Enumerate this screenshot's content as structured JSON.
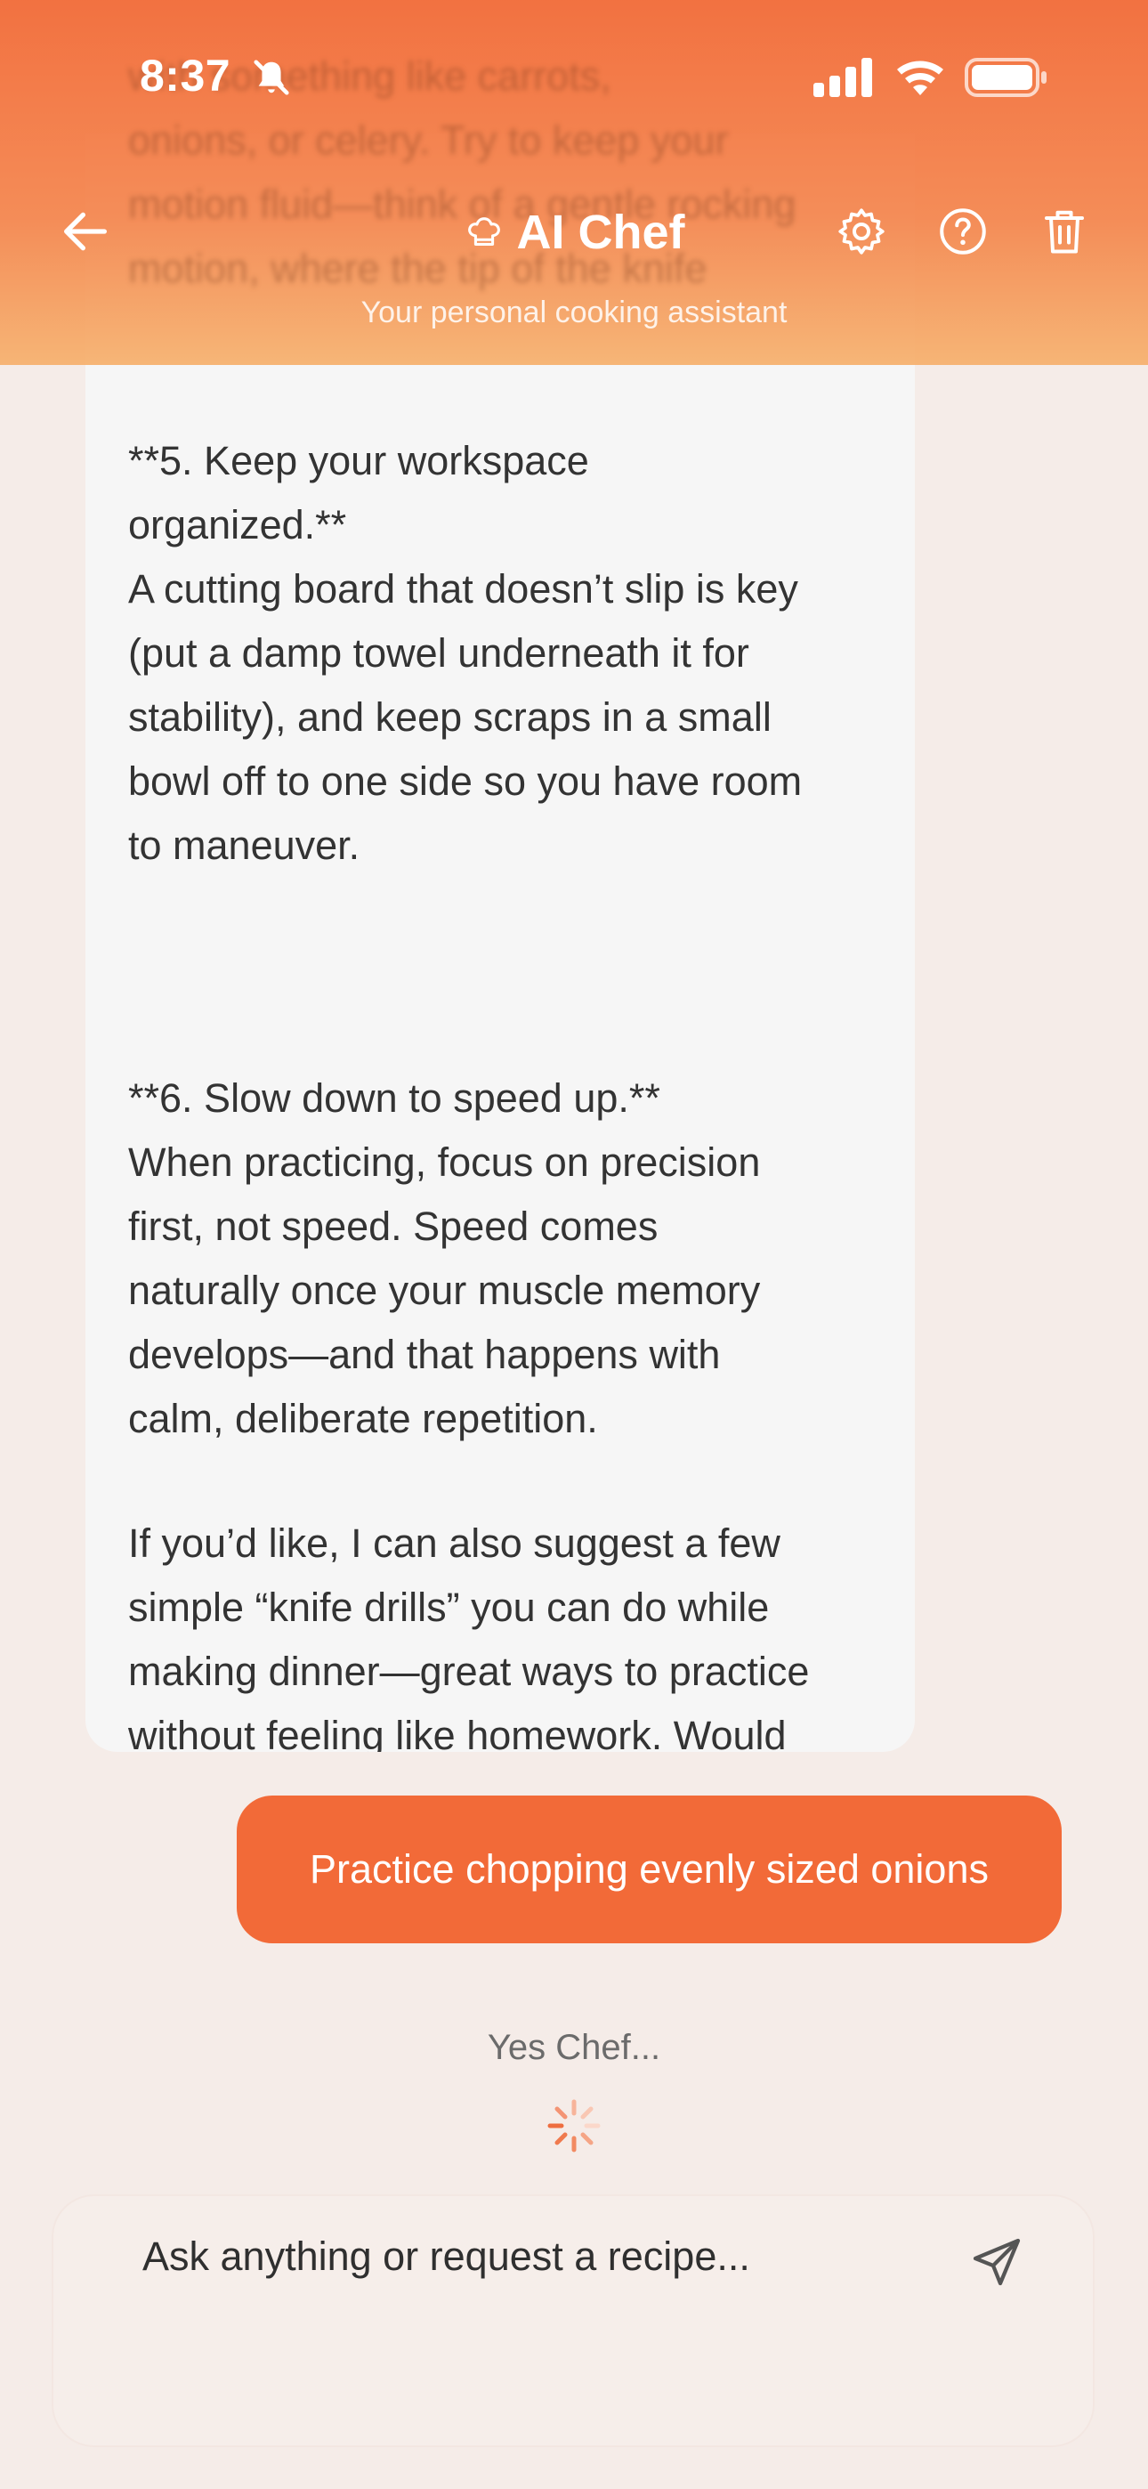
{
  "status_bar": {
    "time": "8:37"
  },
  "header": {
    "title": "AI Chef",
    "subtitle": "Your personal cooking assistant",
    "title_icon": "chef-hat-icon",
    "actions": [
      "settings-icon",
      "help-icon",
      "trash-icon"
    ],
    "ghost_text": "with something like carrots,\nonions, or celery. Try to keep your\nmotion fluid—think of a gentle rocking\nmotion, where the tip of the knife"
  },
  "messages": {
    "assistant": {
      "faded_line": "",
      "para5": "**5. Keep your workspace\norganized.**\nA cutting board that doesn’t slip is key\n(put a damp towel underneath it for\nstability), and keep scraps in a small\nbowl off to one side so you have room\nto maneuver.",
      "para6": "**6. Slow down to speed up.**\nWhen practicing, focus on precision\nfirst, not speed. Speed comes\nnaturally once your muscle memory\ndevelops—and that happens with\ncalm, deliberate repetition.",
      "para7": "If you’d like, I can also suggest a few\nsimple “knife drills” you can do while\nmaking dinner—great ways to practice\nwithout feeling like homework. Would\nyou like me to share a few of those?"
    },
    "user": {
      "text": "Practice chopping evenly sized onions"
    },
    "typing_label": "Yes Chef..."
  },
  "composer": {
    "placeholder": "Ask anything or request a recipe..."
  },
  "colors": {
    "accent": "#f26a38",
    "background": "#f5ece8",
    "assistant_bubble": "#f6f6f6"
  }
}
